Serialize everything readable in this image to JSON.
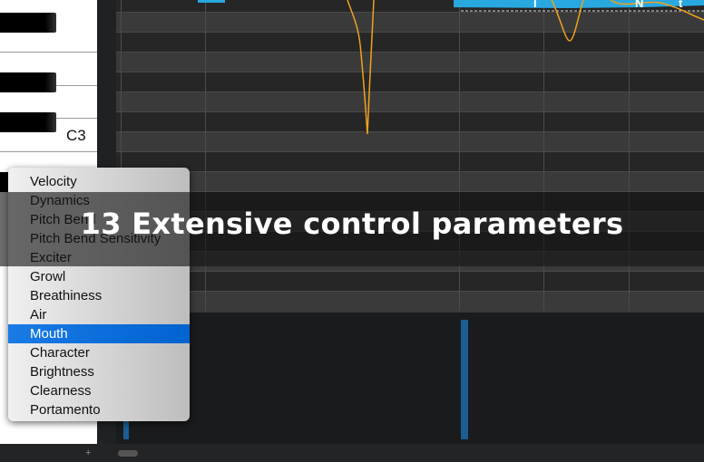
{
  "piano": {
    "note_label": "C3"
  },
  "editor": {
    "lyrics": [
      "l",
      "N",
      "t"
    ],
    "colors": {
      "waveform": "#29a8e0",
      "pitch_curve": "#f0a020",
      "velocity_bar": "#1d5e92",
      "selection": "#0a6fe0"
    }
  },
  "parameter_menu": {
    "items": [
      "Velocity",
      "Dynamics",
      "Pitch Bend",
      "Pitch Bend Sensitivity",
      "Exciter",
      "Growl",
      "Breathiness",
      "Air",
      "Mouth",
      "Character",
      "Brightness",
      "Clearness",
      "Portamento"
    ],
    "selected": "Mouth"
  },
  "overlay": {
    "headline": "13 Extensive control parameters"
  },
  "footer": {
    "add_label": "+"
  }
}
